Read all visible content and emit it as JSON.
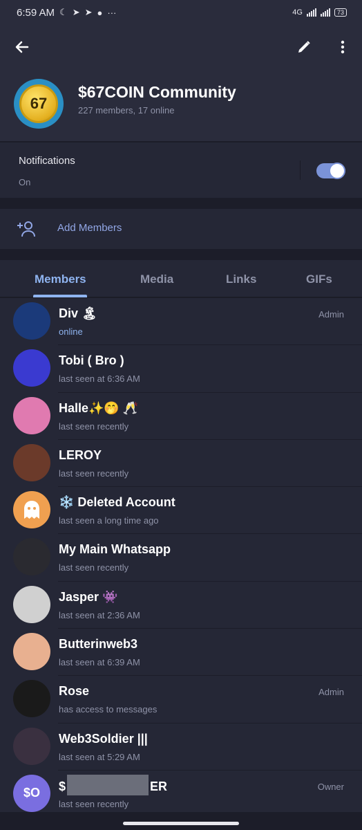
{
  "status_bar": {
    "time": "6:59 AM",
    "icons": [
      "moon-icon",
      "telegram-icon",
      "telegram-icon",
      "chat-icon",
      "more-dots-icon"
    ],
    "network": "4G",
    "battery": "73"
  },
  "header": {
    "title": "$67COIN Community",
    "subtitle": "227 members, 17 online",
    "avatar_text": "67"
  },
  "notifications": {
    "label": "Notifications",
    "value": "On",
    "enabled": true
  },
  "add_members": {
    "label": "Add Members"
  },
  "tabs": [
    {
      "label": "Members",
      "active": true
    },
    {
      "label": "Media",
      "active": false
    },
    {
      "label": "Links",
      "active": false
    },
    {
      "label": "GIFs",
      "active": false
    }
  ],
  "members": [
    {
      "name": "Div 🏝",
      "status": "online",
      "online": true,
      "role": "Admin",
      "avatar_color": "#1b3a7a"
    },
    {
      "name": "Tobi ( Bro )",
      "status": "last seen at 6:36 AM",
      "online": false,
      "role": "",
      "avatar_color": "#3a3ad0"
    },
    {
      "name": "Halle✨🤭 🥂",
      "status": "last seen recently",
      "online": false,
      "role": "",
      "avatar_color": "#e07ab0"
    },
    {
      "name": "LEROY",
      "status": "last seen recently",
      "online": false,
      "role": "",
      "avatar_color": "#6b3a2a"
    },
    {
      "name": "❄️ Deleted Account",
      "status": "last seen a long time ago",
      "online": false,
      "role": "",
      "avatar_color": "#f0a050"
    },
    {
      "name": "My Main Whatsapp",
      "status": "last seen recently",
      "online": false,
      "role": "",
      "avatar_color": "#2a2a30"
    },
    {
      "name": "Jasper 👾",
      "status": "last seen at 2:36 AM",
      "online": false,
      "role": "",
      "avatar_color": "#d0d0d0"
    },
    {
      "name": "Butterinweb3",
      "status": "last seen at 6:39 AM",
      "online": false,
      "role": "",
      "avatar_color": "#e8b090"
    },
    {
      "name": "Rose",
      "status": "has access to messages",
      "online": false,
      "role": "Admin",
      "avatar_color": "#1a1a1a"
    },
    {
      "name": "Web3Soldier |||",
      "status": "last seen at 5:29 AM",
      "online": false,
      "role": "",
      "avatar_color": "#3a3040"
    },
    {
      "name_prefix": "$",
      "name_suffix": "ER",
      "status": "last seen recently",
      "online": false,
      "role": "Owner",
      "avatar_text": "$O",
      "avatar_color": "#7a6ee0"
    }
  ]
}
